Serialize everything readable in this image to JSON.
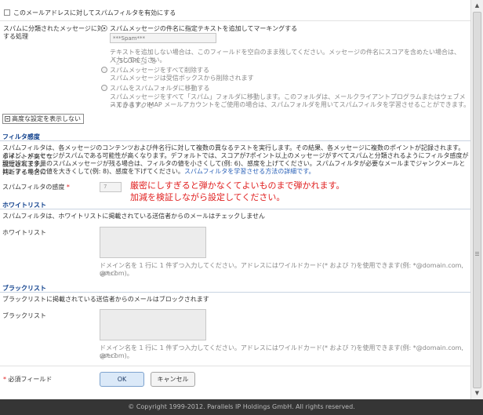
{
  "enable_filter": {
    "label": "このメールアドレスに対してスパムフィルタを有効にする",
    "checked": false
  },
  "processing": {
    "label_line1": "スパムに分類されたメッセージに対",
    "label_line2": "する処理",
    "opt_mark": {
      "label": "スパムメッセージの件名に指定テキストを追加してマーキングする",
      "checked": true
    },
    "subject_tag_placeholder": "***Spam***",
    "mark_help_line1": "テキストを追加しない場合は、このフィールドを空白のまま残してください。メッセージの件名にスコアを含めたい場合は、「_SCORE_」を",
    "mark_help_line2": "入力してください。",
    "opt_delete": {
      "label": "スパムメッセージをすべて削除する",
      "checked": false
    },
    "delete_help": "スパムメッセージは受信ボックスから削除されます",
    "opt_move": {
      "label": "スパムをスパムフォルダに移動する",
      "checked": false
    },
    "move_help_line1": "スパムメッセージをすべて「スパム」フォルダに移動します。このフォルダは、メールクライアントプログラムまたはウェブメールからアクセ",
    "move_help_line2": "スできます。IMAP メールアカウントをご使用の場合は、スパムフォルダを用いてスパムフィルタを学習させることができます。"
  },
  "advanced_toggle": {
    "icon": "minus-box-icon",
    "label": "高度な設定を表示しない"
  },
  "sensitivity_section": {
    "title": "フィルタ感度",
    "desc_line1": "スパムフィルタは、各メッセージのコンテンツおよび件名行に対して複数の異なるテストを実行します。その結果、各メッセージに複数のポイントが記録されます。ポイントが高くな",
    "desc_line2": "るほど、メッセージがスパムである可能性が高くなります。デフォルトでは、スコアが7ポイント以上のメッセージがすべてスパムと分類されるようにフィルタ感度が設定されます。",
    "desc_line3": "現行設定で多量のスパムメッセージが残る場合は、フィルタの値を小さくして(例: 6)、感度を上げてください。スパムフィルタが必要なメールまでジャンクメールと判断する場合に",
    "desc_line4": "は、フィルタの値を大きくして(例: 8)、感度を下げてください。",
    "link": "スパムフィルタを学習させる方法の詳細です。",
    "field_label": "スパムフィルタの感度",
    "required_mark": "*",
    "value": "7"
  },
  "annotation": {
    "line1": "厳密にしすぎると弾かなくてよいものまで弾かれます。",
    "line2": "加減を検証しながら設定してください。",
    "color": "#e02020"
  },
  "whitelist": {
    "title": "ホワイトリスト",
    "desc": "スパムフィルタは、ホワイトリストに掲載されている送信者からのメールはチェックしません",
    "field_label": "ホワイトリスト",
    "help_line1": "ドメイン名を 1 行に 1 件ずつ入力してください。アドレスにはワイルドカード(* および ?)を使用できます(例: *@domain.com, user?",
    "help_line2": "@*.com)。"
  },
  "blacklist": {
    "title": "ブラックリスト",
    "desc": "ブラックリストに掲載されている送信者からのメールはブロックされます",
    "field_label": "ブラックリスト",
    "help_line1": "ドメイン名を 1 行に 1 件ずつ入力してください。アドレスにはワイルドカード(* および ?)を使用できます(例: *@domain.com, user?",
    "help_line2": "@*.com)。"
  },
  "required_note": {
    "mark": "*",
    "label": "必須フィールド"
  },
  "buttons": {
    "ok": "OK",
    "cancel": "キャンセル"
  },
  "footer": {
    "copyright": "© Copyright 1999-2012. Parallels IP Holdings GmbH. All rights reserved."
  },
  "colors": {
    "section_title": "#0b3d8b",
    "link": "#2b62b8",
    "ok_bg": "#dbe9f8",
    "footer_bg": "#353535"
  }
}
